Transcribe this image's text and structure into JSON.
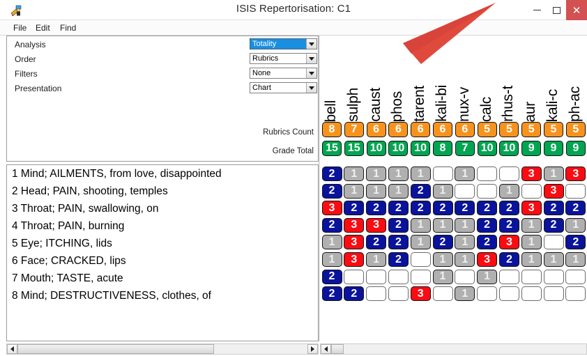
{
  "window": {
    "title": "ISIS Repertorisation: C1",
    "icon": "app-person-icon",
    "minimize_label": "–",
    "maximize_label": "□",
    "close_label": "✕",
    "close_color": "#d35152"
  },
  "menubar": {
    "items": [
      {
        "label": "File"
      },
      {
        "label": "Edit"
      },
      {
        "label": "Find"
      }
    ]
  },
  "options": {
    "rows": [
      {
        "label": "Analysis",
        "value": "Totality",
        "selected": true
      },
      {
        "label": "Order",
        "value": "Rubrics",
        "selected": false
      },
      {
        "label": "Filters",
        "value": "None",
        "selected": false
      },
      {
        "label": "Presentation",
        "value": "Chart",
        "selected": false
      }
    ],
    "summary_labels": {
      "rubrics_count": "Rubrics Count",
      "grade_total": "Grade Total"
    }
  },
  "rubrics": [
    "1 Mind; AILMENTS, from love, disappointed",
    "2 Head; PAIN, shooting, temples",
    "3 Throat; PAIN, swallowing, on",
    "4 Throat; PAIN, burning",
    "5 Eye; ITCHING, lids",
    "6 Face; CRACKED, lips",
    "7 Mouth; TASTE, acute",
    "8 Mind; DESTRUCTIVENESS, clothes, of"
  ],
  "colors": {
    "grade1": "#b0b0b0",
    "grade2": "#0a139c",
    "grade3": "#fb0b12",
    "grade0": "#ffffff",
    "rubrics_count_pill": "#f7931d",
    "grade_total_pill": "#00a651",
    "combo_selected": "#1a8fe0",
    "annotation_arrow": "#e04a3c"
  },
  "chart_data": {
    "type": "heatmap",
    "title": "ISIS Repertorisation: C1",
    "xlabel": "",
    "ylabel": "",
    "grid": true,
    "legend": "none",
    "remedies": [
      "bell",
      "sulph",
      "caust",
      "phos",
      "tarent",
      "kali-bi",
      "nux-v",
      "calc",
      "rhus-t",
      "aur",
      "kali-c",
      "ph-ac"
    ],
    "rubrics_count": [
      8,
      7,
      6,
      6,
      6,
      6,
      6,
      5,
      5,
      5,
      5,
      5
    ],
    "grade_total": [
      15,
      15,
      10,
      10,
      10,
      8,
      7,
      10,
      10,
      9,
      9,
      9
    ],
    "rubric_labels": [
      "1 Mind; AILMENTS, from love, disappointed",
      "2 Head; PAIN, shooting, temples",
      "3 Throat; PAIN, swallowing, on",
      "4 Throat; PAIN, burning",
      "5 Eye; ITCHING, lids",
      "6 Face; CRACKED, lips",
      "7 Mouth; TASTE, acute",
      "8 Mind; DESTRUCTIVENESS, clothes, of"
    ],
    "grades": [
      [
        2,
        1,
        1,
        1,
        1,
        0,
        1,
        0,
        0,
        3,
        1,
        3
      ],
      [
        2,
        1,
        1,
        1,
        2,
        1,
        0,
        0,
        1,
        0,
        3,
        0
      ],
      [
        3,
        2,
        2,
        2,
        2,
        2,
        2,
        2,
        2,
        3,
        2,
        2
      ],
      [
        2,
        3,
        3,
        2,
        1,
        1,
        1,
        2,
        2,
        1,
        2,
        1
      ],
      [
        1,
        3,
        2,
        2,
        1,
        2,
        1,
        2,
        3,
        1,
        0,
        2
      ],
      [
        1,
        3,
        1,
        2,
        0,
        1,
        1,
        3,
        2,
        1,
        1,
        1
      ],
      [
        2,
        0,
        0,
        0,
        0,
        1,
        0,
        1,
        0,
        0,
        0,
        0
      ],
      [
        2,
        2,
        0,
        0,
        3,
        0,
        1,
        0,
        0,
        0,
        0,
        0
      ]
    ],
    "grade_scale": [
      0,
      1,
      2,
      3
    ]
  },
  "scrollbars": {
    "left_arrow": "◀",
    "right_arrow": "▶"
  }
}
